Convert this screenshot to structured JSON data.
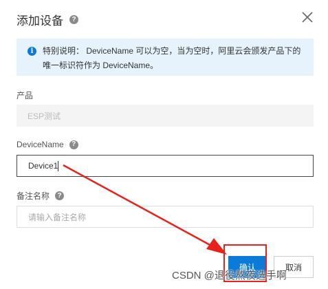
{
  "dialog": {
    "title": "添加设备",
    "help_icon": "?",
    "close_icon": "close-icon"
  },
  "notice": {
    "icon": "i",
    "text": "特别说明： DeviceName 可以为空，当为空时，阿里云会颁发产品下的唯一标识符作为 DeviceName。"
  },
  "product": {
    "label": "产品",
    "value": "ESP测试"
  },
  "device_name": {
    "label": "DeviceName",
    "help_icon": "?",
    "value": "Device1"
  },
  "remark": {
    "label": "备注名称",
    "help_icon": "?",
    "placeholder": "请输入备注名称"
  },
  "buttons": {
    "confirm": "确认",
    "cancel": "取消"
  },
  "annotation": {
    "color": "#e8211b"
  },
  "watermark": "CSDN @退役熬夜选手啊",
  "colors": {
    "primary": "#0b7ad8",
    "notice_bg": "#e6f3fd",
    "annotation": "#e8211b"
  }
}
